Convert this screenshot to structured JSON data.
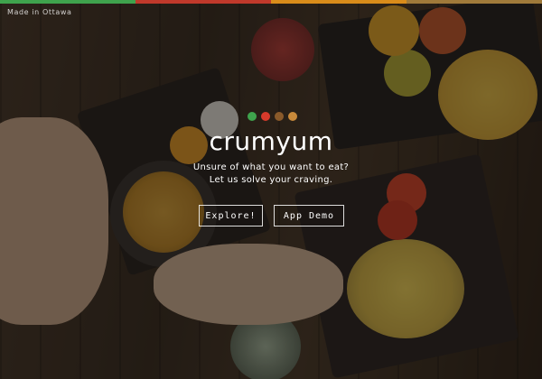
{
  "brand": {
    "logo_text": "crumyum",
    "location_note": "Made in Ottawa"
  },
  "hero": {
    "tagline_line1": "Unsure of what you want to eat?",
    "tagline_line2": "Let us solve your craving."
  },
  "buttons": {
    "explore_label": "Explore!",
    "demo_label": "App Demo"
  },
  "colors": {
    "topbar": [
      "#3fa34d",
      "#c0392b",
      "#d98c1a",
      "#a07a3a"
    ],
    "dots": [
      "#3fa34d",
      "#d83a2b",
      "#8a5a2a",
      "#c98a3a"
    ],
    "overlay": "#0a0806"
  }
}
